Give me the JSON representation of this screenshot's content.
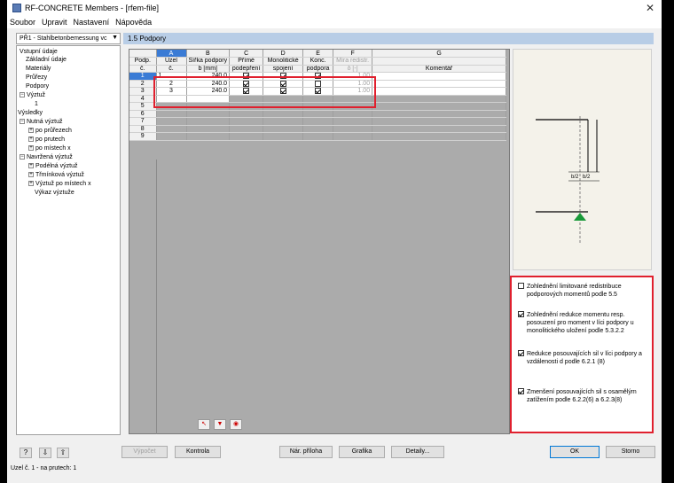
{
  "window": {
    "title": "RF-CONCRETE Members - [rfem-file]"
  },
  "menu": [
    "Soubor",
    "Upravit",
    "Nastavení",
    "Nápověda"
  ],
  "module_select": {
    "value": "PŘ1 - Stahlbetonbemessung vc"
  },
  "panel_title": "1.5 Podpory",
  "tree": {
    "input": "Vstupní údaje",
    "basic": "Základní údaje",
    "materials": "Materiály",
    "sections": "Průřezy",
    "supports": "Podpory",
    "reinf": "Výztuž",
    "reinf1": "1",
    "results": "Výsledky",
    "required": "Nutná výztuž",
    "req_sec": "po průřezech",
    "req_mem": "po prutech",
    "req_x": "po místech x",
    "provided": "Navržená výztuž",
    "long": "Podélná výztuž",
    "stirrup": "Třmínková výztuž",
    "prov_x": "Výztuž po místech x",
    "bill": "Výkaz výztuže"
  },
  "table": {
    "col_letters": [
      "A",
      "B",
      "C",
      "D",
      "E",
      "F",
      "G"
    ],
    "h1": [
      "Podp.",
      "Uzel",
      "Šířka podpory",
      "Přímé",
      "Monolitické",
      "Konc.",
      "Míra redistr.",
      ""
    ],
    "h2": [
      "č.",
      "č.",
      "b [mm]",
      "podepření",
      "spojení",
      "podpora",
      "δ [-]",
      "Komentář"
    ],
    "rows": [
      {
        "no": "1",
        "node": "1",
        "width": "240.0",
        "direct": true,
        "mono": true,
        "end": true,
        "delta": "1.00",
        "comment": ""
      },
      {
        "no": "2",
        "node": "2",
        "width": "240.0",
        "direct": true,
        "mono": true,
        "end": false,
        "delta": "1.00",
        "comment": ""
      },
      {
        "no": "3",
        "node": "3",
        "width": "240.0",
        "direct": true,
        "mono": true,
        "end": true,
        "delta": "1.00",
        "comment": ""
      }
    ],
    "empty_rows": [
      "4",
      "5",
      "6",
      "7",
      "8",
      "9"
    ]
  },
  "preview": {
    "dim1": "b/2",
    "dim2": "b/2"
  },
  "options": [
    {
      "checked": false,
      "text": "Zohlednění limitované redistribuce podporových momentů podle 5.5"
    },
    {
      "checked": true,
      "text": "Zohlednění redukce momentu resp. posouzení pro moment v líci podpory u monolitického uložení podle 5.3.2.2"
    },
    {
      "checked": true,
      "text": "Redukce posouvajících sil v líci podpory a vzdálenosti d podle 6.2.1 (8)"
    },
    {
      "checked": true,
      "text": "Zmenšení posouvajících sil s osamělým zatížením podle 6.2.2(6) a 6.2.3(8)"
    }
  ],
  "buttons": {
    "calc": "Výpočet",
    "check": "Kontrola",
    "annex": "Nár. příloha",
    "graphics": "Grafika",
    "details": "Detaily...",
    "ok": "OK",
    "cancel": "Storno"
  },
  "status": "Uzel č. 1  -  na prutech: 1"
}
